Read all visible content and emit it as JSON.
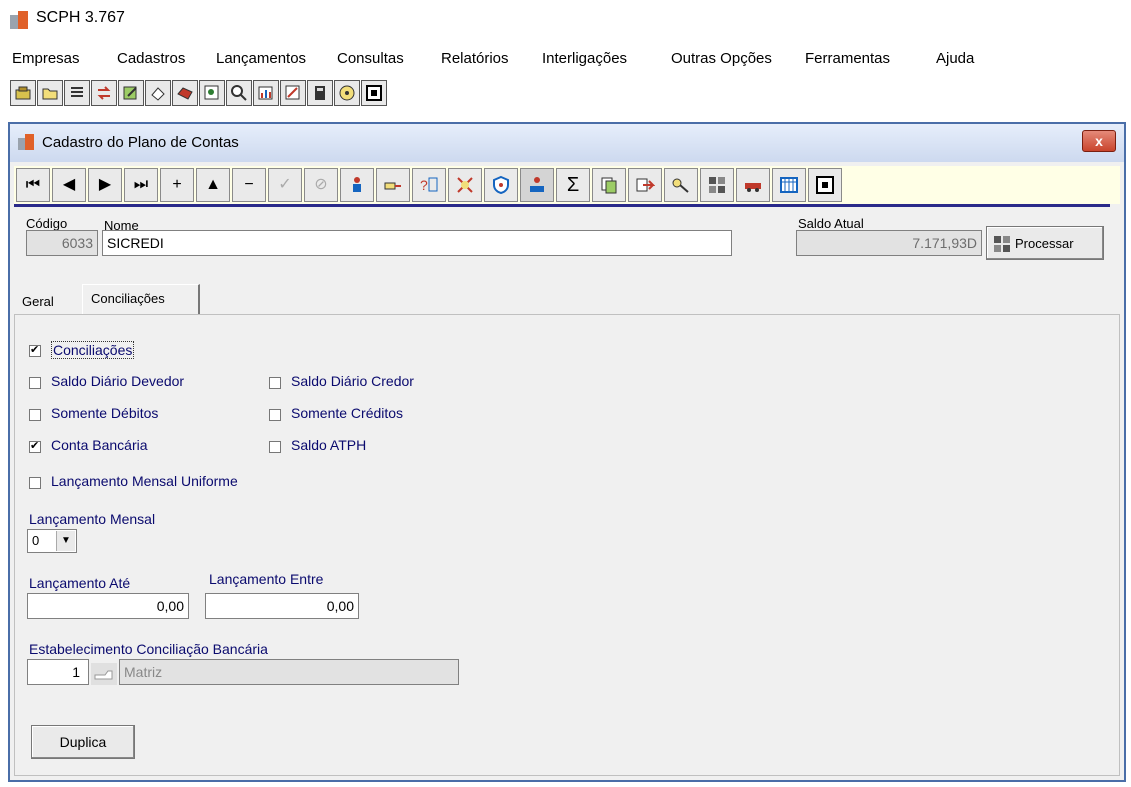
{
  "app": {
    "title": "SCPH 3.767"
  },
  "menu": [
    "Empresas",
    "Cadastros",
    "Lançamentos",
    "Consultas",
    "Relatórios",
    "Interligações",
    "Outras Opções",
    "Ferramentas",
    "Ajuda"
  ],
  "window": {
    "title": "Cadastro do Plano de Contas",
    "close_label": "x"
  },
  "nav_buttons": [
    "⏮",
    "◀",
    "▶",
    "⏭",
    "+",
    "▲",
    "−",
    "✓",
    "⊘"
  ],
  "form": {
    "codigo_label": "Código",
    "codigo_value": "6033",
    "nome_label": "Nome",
    "nome_value": "SICREDI",
    "saldo_label": "Saldo Atual",
    "saldo_value": "7.171,93D",
    "processar_label": "Processar"
  },
  "tabs": {
    "geral": "Geral",
    "conciliacoes": "Conciliações"
  },
  "checkboxes": {
    "conciliacoes": {
      "label": "Conciliações",
      "checked": true
    },
    "saldo_devedor": {
      "label": "Saldo Diário Devedor",
      "checked": false
    },
    "saldo_credor": {
      "label": "Saldo Diário Credor",
      "checked": false
    },
    "somente_debitos": {
      "label": "Somente Débitos",
      "checked": false
    },
    "somente_creditos": {
      "label": "Somente Créditos",
      "checked": false
    },
    "conta_bancaria": {
      "label": "Conta Bancária",
      "checked": true
    },
    "saldo_atph": {
      "label": "Saldo ATPH",
      "checked": false
    },
    "lanc_uniforme": {
      "label": "Lançamento Mensal Uniforme",
      "checked": false
    }
  },
  "lanc_mensal": {
    "label": "Lançamento Mensal",
    "value": "0"
  },
  "lanc_ate": {
    "label": "Lançamento Até",
    "value": "0,00"
  },
  "lanc_entre": {
    "label": "Lançamento Entre",
    "value": "0,00"
  },
  "estab": {
    "label": "Estabelecimento Conciliação Bancária",
    "code": "1",
    "name": "Matriz"
  },
  "duplica_label": "Duplica",
  "colors": {
    "accent": "#4a6ea8",
    "label_blue": "#0a0a6e",
    "nav_bg": "#ffffe6"
  }
}
